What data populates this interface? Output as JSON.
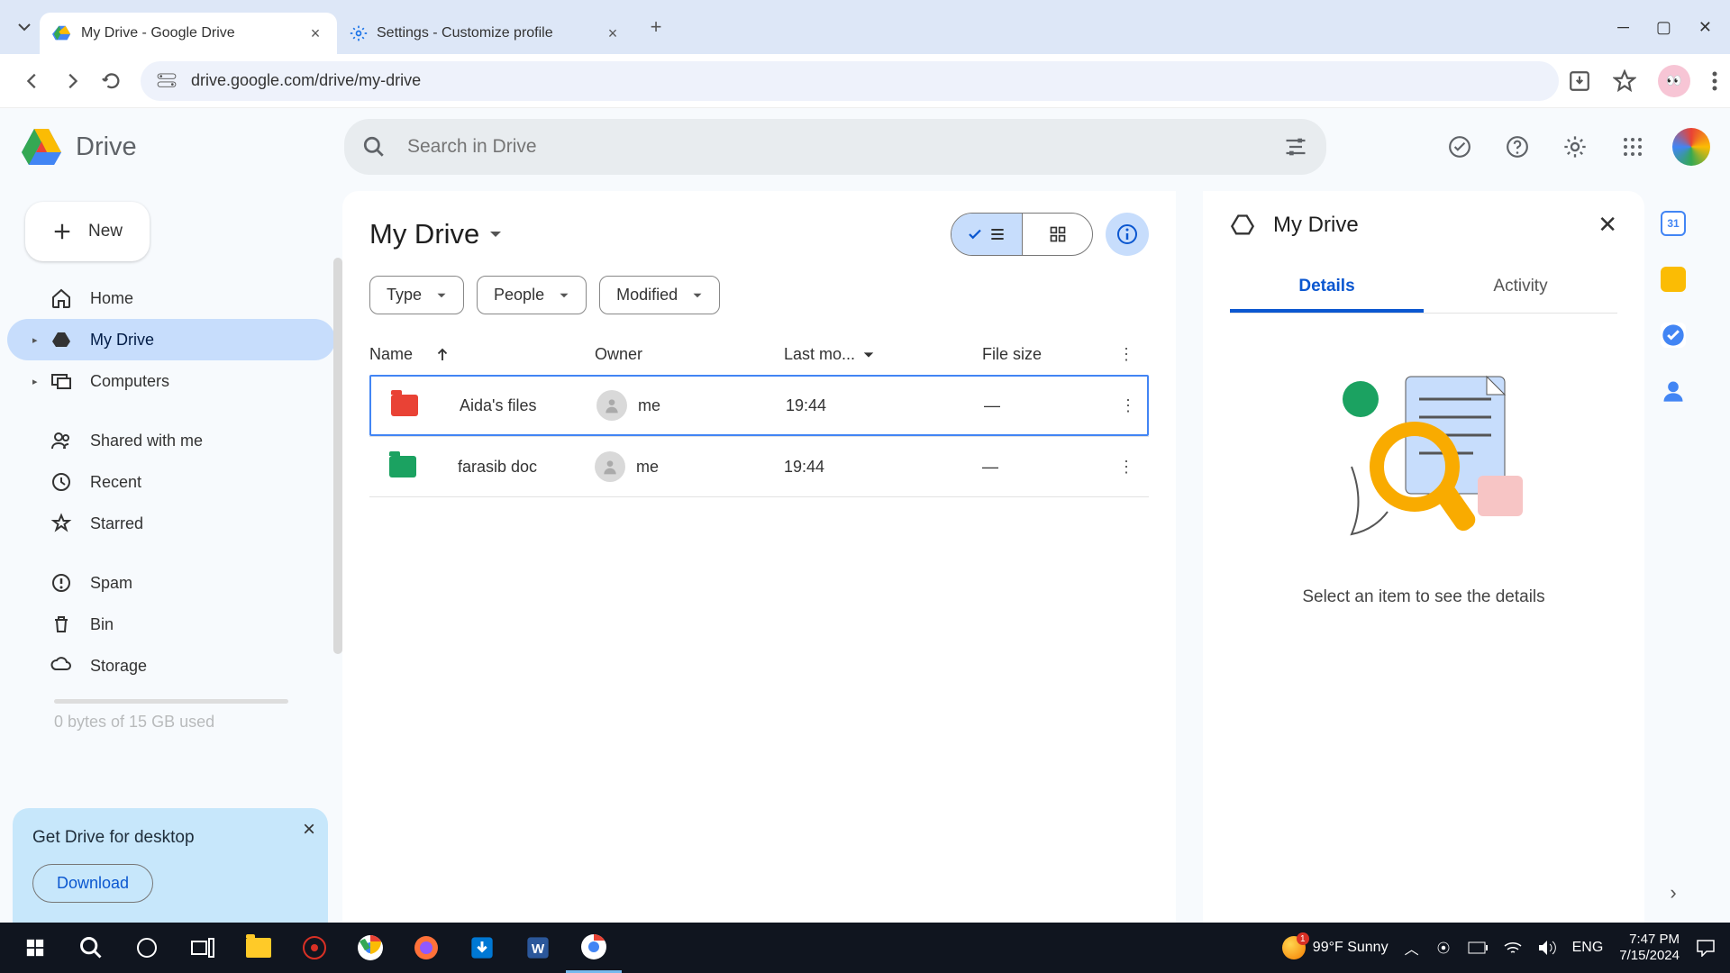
{
  "browser": {
    "tabs": [
      {
        "title": "My Drive - Google Drive"
      },
      {
        "title": "Settings - Customize profile"
      }
    ],
    "url": "drive.google.com/drive/my-drive"
  },
  "drive": {
    "brand": "Drive",
    "search_placeholder": "Search in Drive",
    "new_label": "New",
    "sidebar": [
      {
        "label": "Home",
        "icon": "home"
      },
      {
        "label": "My Drive",
        "icon": "drive",
        "active": true,
        "expandable": true
      },
      {
        "label": "Computers",
        "icon": "computers",
        "expandable": true
      },
      {
        "spacer": true
      },
      {
        "label": "Shared with me",
        "icon": "shared"
      },
      {
        "label": "Recent",
        "icon": "recent"
      },
      {
        "label": "Starred",
        "icon": "starred"
      },
      {
        "spacer": true
      },
      {
        "label": "Spam",
        "icon": "spam"
      },
      {
        "label": "Bin",
        "icon": "bin"
      },
      {
        "label": "Storage",
        "icon": "storage"
      }
    ],
    "storage_text": "0 bytes of 15 GB used",
    "promo": {
      "title": "Get Drive for desktop",
      "button": "Download"
    },
    "breadcrumb": "My Drive",
    "chips": [
      "Type",
      "People",
      "Modified"
    ],
    "columns": {
      "name": "Name",
      "owner": "Owner",
      "modified": "Last mo...",
      "size": "File size"
    },
    "rows": [
      {
        "name": "Aida's files",
        "owner": "me",
        "modified": "19:44",
        "size": "—",
        "color": "red",
        "selected": true
      },
      {
        "name": "farasib doc",
        "owner": "me",
        "modified": "19:44",
        "size": "—",
        "color": "green"
      }
    ],
    "details": {
      "title": "My Drive",
      "tabs": {
        "details": "Details",
        "activity": "Activity"
      },
      "empty_msg": "Select an item to see the details"
    }
  },
  "taskbar": {
    "weather": "99°F  Sunny",
    "weather_badge": "1",
    "lang": "ENG",
    "time": "7:47 PM",
    "date": "7/15/2024"
  }
}
